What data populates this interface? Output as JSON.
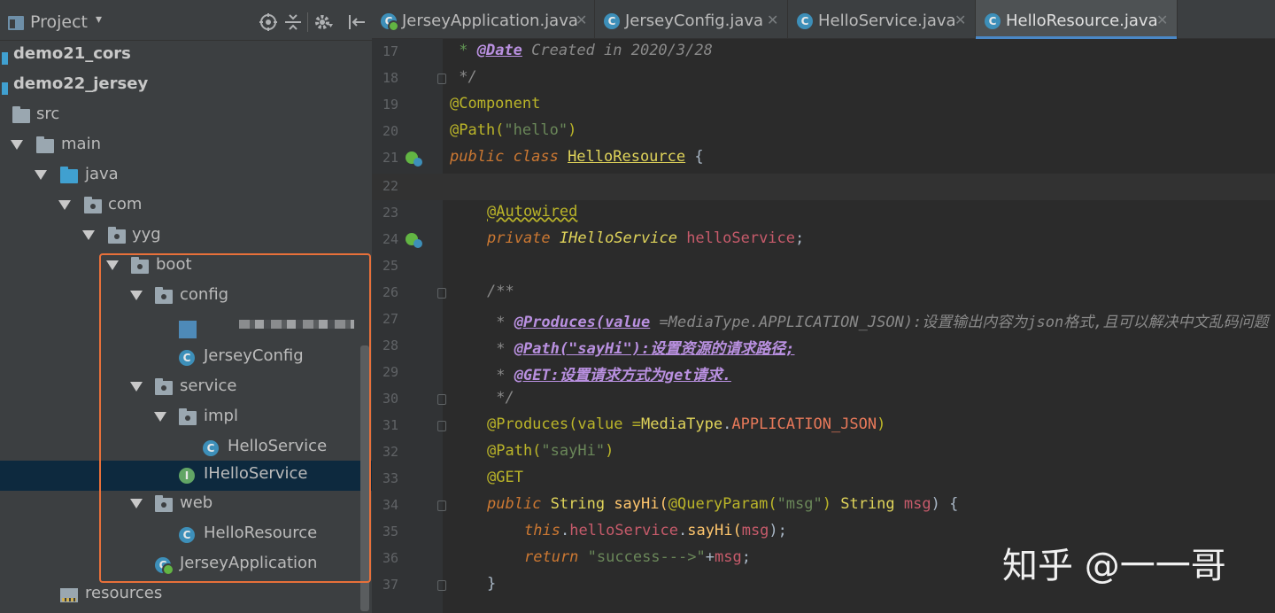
{
  "project_panel": {
    "title": "Project",
    "dropdown": "▾",
    "tree": [
      {
        "label": "demo21_cors"
      },
      {
        "label": "demo22_jersey"
      },
      {
        "label": "src"
      },
      {
        "label": "main"
      },
      {
        "label": "java"
      },
      {
        "label": "com"
      },
      {
        "label": "yyg"
      },
      {
        "label": "boot"
      },
      {
        "label": "config"
      },
      {
        "label": ""
      },
      {
        "label": "JerseyConfig"
      },
      {
        "label": "service"
      },
      {
        "label": "impl"
      },
      {
        "label": "HelloService"
      },
      {
        "label": "IHelloService"
      },
      {
        "label": "web"
      },
      {
        "label": "HelloResource"
      },
      {
        "label": "JerseyApplication"
      },
      {
        "label": "resources"
      }
    ]
  },
  "tabs": [
    {
      "label": "JerseyApplication.java",
      "icon": "spring-boot-class-icon"
    },
    {
      "label": "JerseyConfig.java",
      "icon": "class-icon"
    },
    {
      "label": "HelloService.java",
      "icon": "class-icon"
    },
    {
      "label": "HelloResource.java",
      "icon": "class-icon",
      "active": true
    }
  ],
  "code": {
    "line_numbers": [
      "17",
      "18",
      "19",
      "20",
      "21",
      "22",
      "23",
      "24",
      "25",
      "26",
      "27",
      "28",
      "29",
      "30",
      "31",
      "32",
      "33",
      "34",
      "35",
      "36",
      "37"
    ],
    "l17": {
      "prefix": " * ",
      "tag": "@Date",
      "text": " Created in 2020/3/28"
    },
    "l18": " */",
    "l19": "@Component",
    "l20": {
      "ann": "@Path(",
      "str": "\"hello\"",
      "close": ")"
    },
    "l21": {
      "kw": "public class ",
      "name": "HelloResource",
      "rest": " {"
    },
    "l23": "@Autowired",
    "l24": {
      "kw": "private ",
      "type": "IHelloService ",
      "field": "helloService",
      "rest": ";"
    },
    "l26": "/**",
    "l27": {
      "prefix": " * ",
      "tag": "@Produces(value",
      "text": " =MediaType.APPLICATION_JSON):设置输出内容为json格式,且可以解决中文乱码问题"
    },
    "l28": {
      "prefix": " * ",
      "tag": "@Path(\"sayHi\"):",
      "text": "设置资源的请求路径;"
    },
    "l29": {
      "prefix": " * ",
      "tag": "@GET:",
      "text": "设置请求方式为get请求."
    },
    "l30": " */",
    "l31": {
      "ann": "@Produces(value =",
      "type": "MediaType",
      "dot": ".",
      "const": "APPLICATION_JSON",
      "close": ")"
    },
    "l32": {
      "ann": "@Path(",
      "str": "\"sayHi\"",
      "close": ")"
    },
    "l33": "@GET",
    "l34": {
      "kw": "public ",
      "type": "String ",
      "meth": "sayHi(",
      "ann": "@QueryParam(",
      "str": "\"msg\"",
      "close": ") ",
      "type2": "String ",
      "field": "msg",
      "rest": ") {"
    },
    "l35": {
      "kw": "this",
      "dot": ".",
      "field": "helloService",
      "dot2": ".",
      "meth": "sayHi(",
      "field2": "msg",
      "rest": ");"
    },
    "l36": {
      "kw": "return ",
      "str": "\"success--->\"",
      "rest": "+",
      "field": "msg",
      "end": ";"
    },
    "l37": "}"
  },
  "watermark": "知乎 @一一哥",
  "colors": {
    "highlight_box": "#e8703a",
    "active_tab_underline": "#4a88c7",
    "selection": "#0d293e"
  }
}
